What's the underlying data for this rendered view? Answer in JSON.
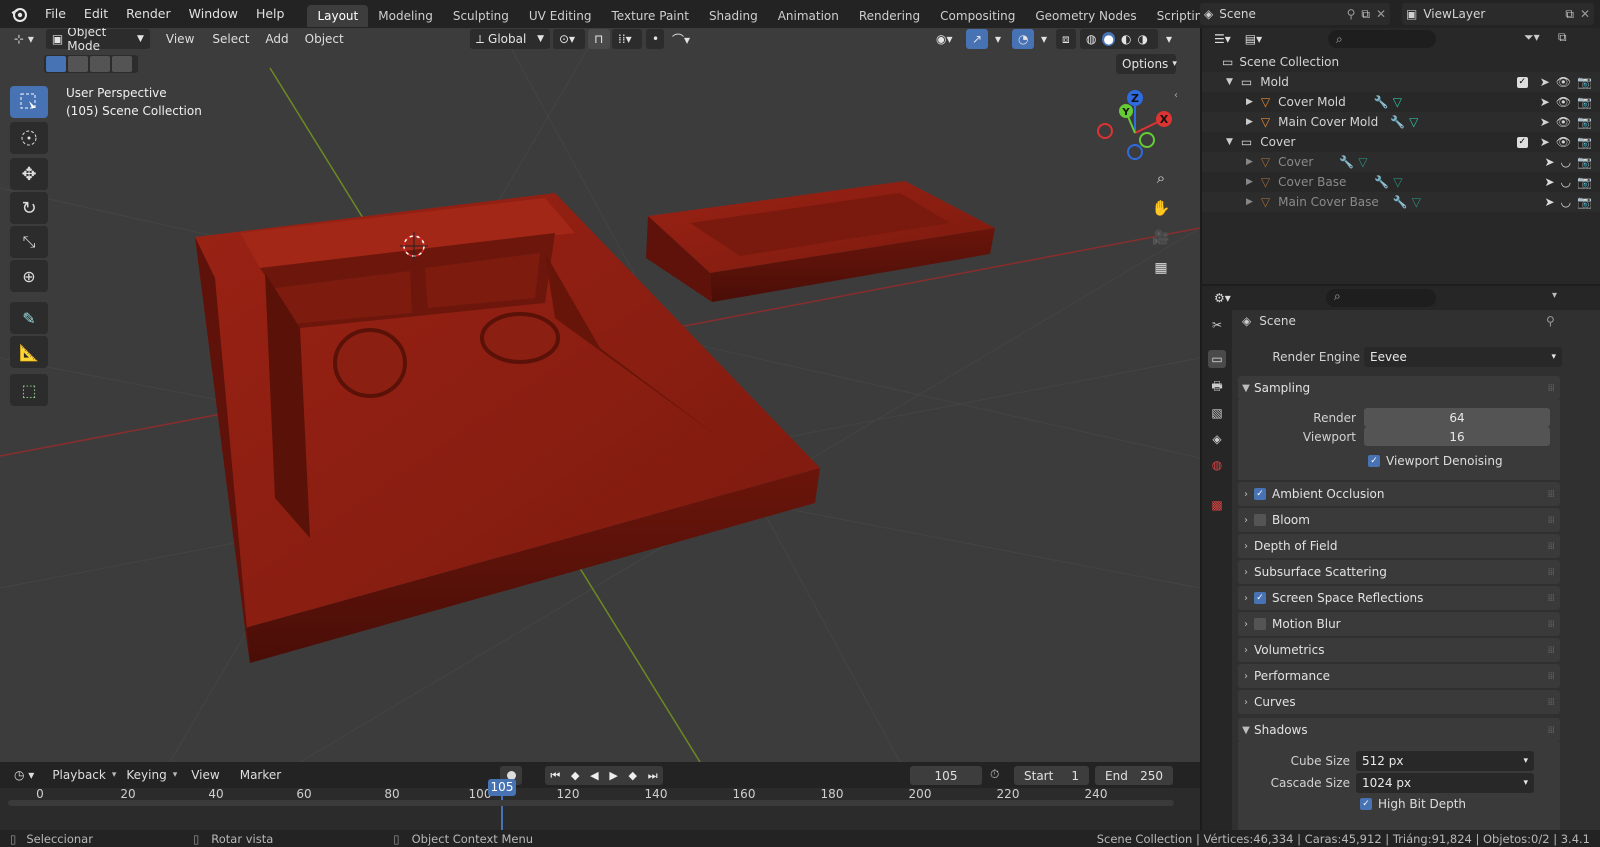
{
  "menu": [
    "File",
    "Edit",
    "Render",
    "Window",
    "Help"
  ],
  "workspaces": [
    "Layout",
    "Modeling",
    "Sculpting",
    "UV Editing",
    "Texture Paint",
    "Shading",
    "Animation",
    "Rendering",
    "Compositing",
    "Geometry Nodes",
    "Scripting"
  ],
  "active_workspace": "Layout",
  "scene_name": "Scene",
  "view_layer": "ViewLayer",
  "viewport": {
    "mode": "Object Mode",
    "menus": [
      "View",
      "Select",
      "Add",
      "Object"
    ],
    "orientation": "Global",
    "options_label": "Options",
    "overlay_line1": "User Perspective",
    "overlay_line2": "(105) Scene Collection",
    "gizmo": {
      "x": "X",
      "y": "Y",
      "z": "Z"
    },
    "object_color": "#8b1a10"
  },
  "outliner": {
    "root": "Scene Collection",
    "rows": [
      {
        "label": "Mold",
        "kind": "collection"
      },
      {
        "label": "Cover Mold",
        "kind": "mesh"
      },
      {
        "label": "Main Cover Mold",
        "kind": "mesh"
      },
      {
        "label": "Cover",
        "kind": "collection"
      },
      {
        "label": "Cover",
        "kind": "mesh-hidden"
      },
      {
        "label": "Cover Base",
        "kind": "mesh-hidden"
      },
      {
        "label": "Main Cover Base",
        "kind": "mesh-hidden"
      }
    ]
  },
  "properties": {
    "context": "Scene",
    "render_engine_label": "Render Engine",
    "render_engine": "Eevee",
    "sampling": {
      "title": "Sampling",
      "render_label": "Render",
      "render": "64",
      "viewport_label": "Viewport",
      "viewport": "16",
      "denoise": "Viewport Denoising"
    },
    "panels": [
      {
        "label": "Ambient Occlusion",
        "checkbox": true,
        "checked": true
      },
      {
        "label": "Bloom",
        "checkbox": true,
        "checked": false
      },
      {
        "label": "Depth of Field",
        "checkbox": false
      },
      {
        "label": "Subsurface Scattering",
        "checkbox": false
      },
      {
        "label": "Screen Space Reflections",
        "checkbox": true,
        "checked": true
      },
      {
        "label": "Motion Blur",
        "checkbox": true,
        "checked": false
      },
      {
        "label": "Volumetrics",
        "checkbox": false
      },
      {
        "label": "Performance",
        "checkbox": false
      },
      {
        "label": "Curves",
        "checkbox": false
      }
    ],
    "shadows": {
      "title": "Shadows",
      "cube_label": "Cube Size",
      "cube": "512 px",
      "cascade_label": "Cascade Size",
      "cascade": "1024 px",
      "high_bit": "High Bit Depth"
    }
  },
  "timeline": {
    "menus": [
      "Playback",
      "Keying",
      "View",
      "Marker"
    ],
    "current_frame": "105",
    "start_label": "Start",
    "start": "1",
    "end_label": "End",
    "end": "250",
    "ruler": [
      "0",
      "20",
      "40",
      "60",
      "80",
      "100",
      "120",
      "140",
      "160",
      "180",
      "200",
      "220",
      "240"
    ]
  },
  "status": {
    "select": "Seleccionar",
    "rotate": "Rotar vista",
    "context": "Object Context Menu",
    "stats": "Scene Collection | Vértices:46,334 | Caras:45,912 | Triáng:91,824 | Objetos:0/2 | 3.4.1"
  }
}
